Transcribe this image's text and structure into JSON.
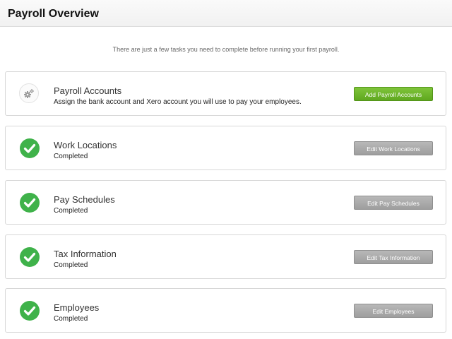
{
  "header": {
    "title": "Payroll Overview"
  },
  "intro": "There are just a few tasks you need to complete before running your first payroll.",
  "colors": {
    "accent_green": "#6cb82a",
    "check_green": "#3fb24a",
    "button_gray": "#a8a8a8"
  },
  "tasks": [
    {
      "title": "Payroll Accounts",
      "subtitle": "Assign the bank account and Xero account you will use to pay your employees.",
      "button": "Add Payroll Accounts",
      "status_icon": "gear-icon",
      "completed": false
    },
    {
      "title": "Work Locations",
      "subtitle": "Completed",
      "button": "Edit Work Locations",
      "status_icon": "check-circle-icon",
      "completed": true
    },
    {
      "title": "Pay Schedules",
      "subtitle": "Completed",
      "button": "Edit Pay Schedules",
      "status_icon": "check-circle-icon",
      "completed": true
    },
    {
      "title": "Tax Information",
      "subtitle": "Completed",
      "button": "Edit Tax Information",
      "status_icon": "check-circle-icon",
      "completed": true
    },
    {
      "title": "Employees",
      "subtitle": "Completed",
      "button": "Edit Employees",
      "status_icon": "check-circle-icon",
      "completed": true
    }
  ]
}
